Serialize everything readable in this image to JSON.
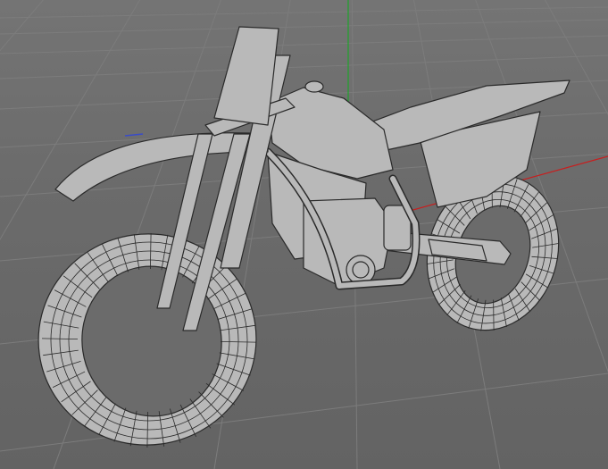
{
  "viewport": {
    "view": "Perspective",
    "background_color": "#6b6b6b",
    "grid_color": "#7c7c7c",
    "axis_colors": {
      "x": "#c81e1e",
      "y": "#1fa32b",
      "z": "#3a4cc8"
    }
  },
  "model": {
    "object": "motocross-bike",
    "display_mode": "wireframe-shaded",
    "surface_color": "#b9b9b9",
    "edge_color": "#2a2a2a"
  }
}
